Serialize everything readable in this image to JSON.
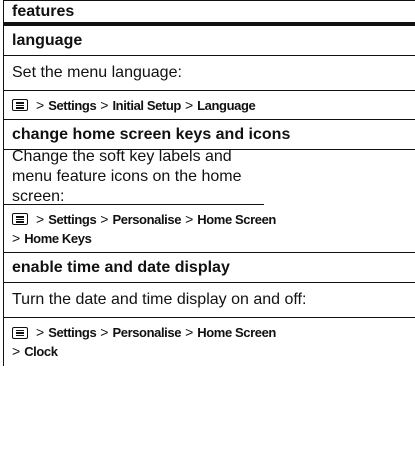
{
  "header": {
    "title": "features"
  },
  "sections": [
    {
      "title": "language",
      "description": "Set the menu language:",
      "path_line1": [
        "Settings",
        "Initial Setup",
        "Language"
      ],
      "path_line2": []
    },
    {
      "title": "change home screen keys and icons",
      "description": "Change the soft key labels and menu feature icons on the home screen:",
      "path_line1": [
        "Settings",
        "Personalise",
        "Home Screen"
      ],
      "path_line2": [
        "Home Keys"
      ]
    },
    {
      "title": "enable time and date display",
      "description": "Turn the date and time display on and off:",
      "path_line1": [
        "Settings",
        "Personalise",
        "Home Screen"
      ],
      "path_line2": [
        "Clock"
      ]
    }
  ],
  "icons": {
    "menu_key": "menu-key-icon"
  },
  "separator": ">"
}
